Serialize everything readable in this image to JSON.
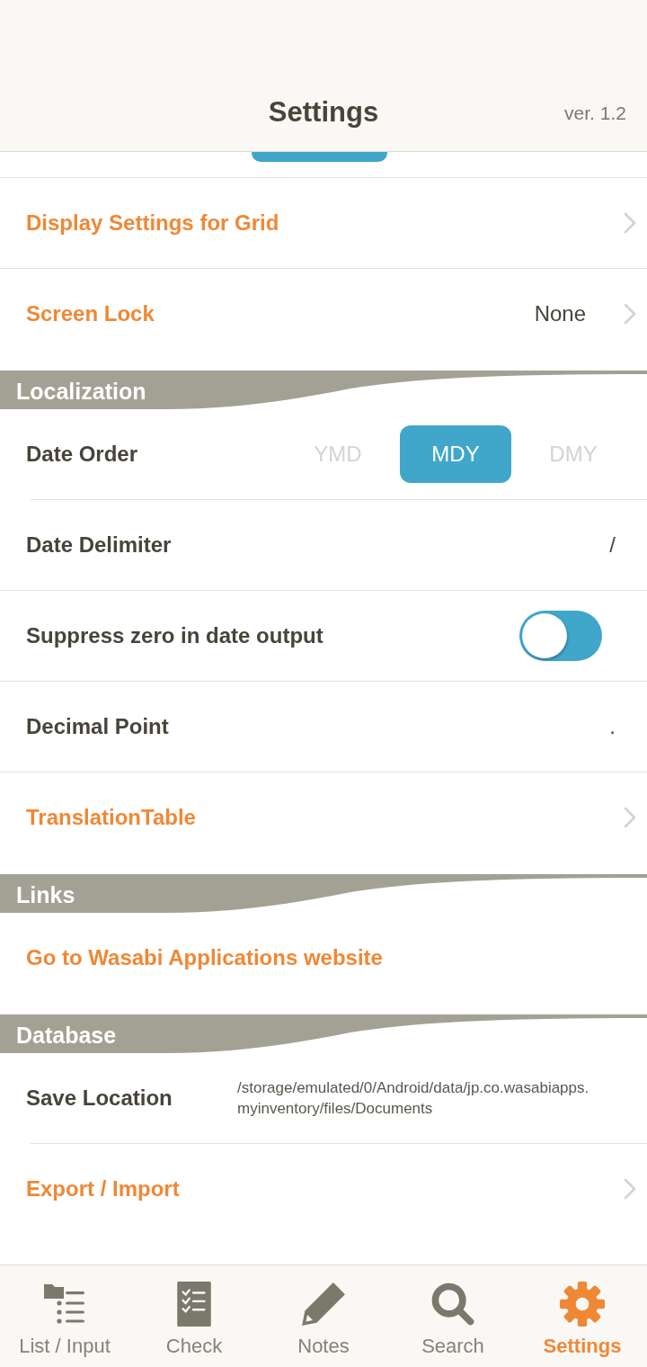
{
  "header": {
    "title": "Settings",
    "version": "ver. 1.2"
  },
  "sections": [
    {
      "rows": [
        {
          "kind": "link",
          "label": "Display Settings for Grid"
        },
        {
          "kind": "link",
          "label": "Screen Lock",
          "value": "None"
        }
      ]
    },
    {
      "title": "Localization",
      "rows": [
        {
          "kind": "segmented",
          "label": "Date Order",
          "options": [
            {
              "label": "YMD",
              "selected": false
            },
            {
              "label": "MDY",
              "selected": true
            },
            {
              "label": "DMY",
              "selected": false
            }
          ]
        },
        {
          "kind": "value",
          "label": "Date Delimiter",
          "value": "/"
        },
        {
          "kind": "toggle",
          "label": "Suppress zero in date output",
          "on": true
        },
        {
          "kind": "value",
          "label": "Decimal Point",
          "value": "."
        },
        {
          "kind": "link",
          "label": "TranslationTable"
        }
      ]
    },
    {
      "title": "Links",
      "rows": [
        {
          "kind": "action",
          "label": "Go to Wasabi Applications website"
        }
      ]
    },
    {
      "title": "Database",
      "rows": [
        {
          "kind": "path",
          "label": "Save Location",
          "value": "/storage/emulated/0/Android/data/jp.co.wasabiapps.\nmyinventory/files/Documents"
        },
        {
          "kind": "link",
          "label": "Export / Import"
        }
      ]
    }
  ],
  "tab_bar": [
    {
      "label": "List / Input",
      "selected": false
    },
    {
      "label": "Check",
      "selected": false
    },
    {
      "label": "Notes",
      "selected": false
    },
    {
      "label": "Search",
      "selected": false
    },
    {
      "label": "Settings",
      "selected": true
    }
  ]
}
